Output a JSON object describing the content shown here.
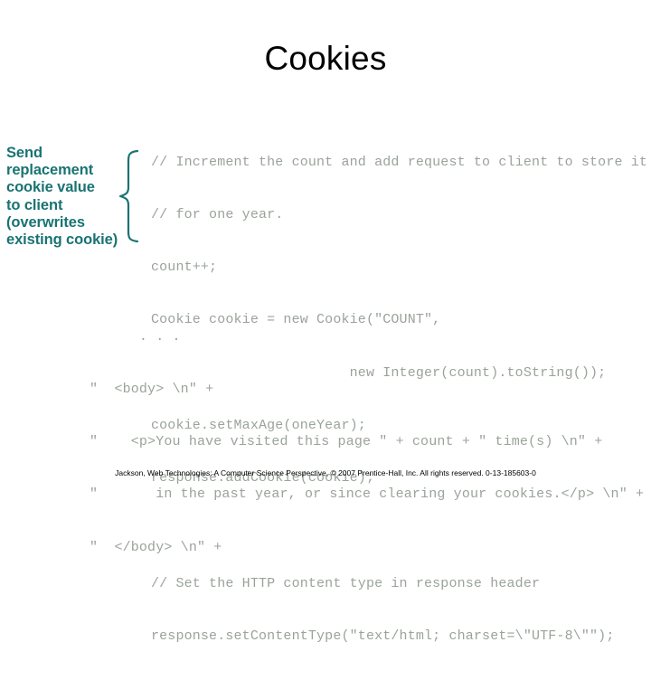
{
  "slide": {
    "title": "Cookies",
    "background_color": "#ffffff",
    "title_color": "#000000"
  },
  "annotation": {
    "color": "#1a7373",
    "lines": [
      "Send",
      "replacement",
      "cookie value",
      "to client",
      "(overwrites",
      "existing cookie)"
    ]
  },
  "brace": {
    "name": "left-curly-brace",
    "color": "#1a7373",
    "orientation": "opening"
  },
  "code": {
    "color": "#9aa39a",
    "lines": [
      "// Increment the count and add request to client to store it",
      "// for one year.",
      "count++;",
      "Cookie cookie = new Cookie(\"COUNT\",",
      "                        new Integer(count).toString());",
      "cookie.setMaxAge(oneYear);",
      "response.addCookie(cookie);",
      "",
      "// Set the HTTP content type in response header",
      "response.setContentType(\"text/html; charset=\\\"UTF-8\\\"\");"
    ]
  },
  "output_code": {
    "color": "#9aa39a",
    "lines": [
      "      . . .",
      "\"  <body> \\n\" +",
      "\"    <p>You have visited this page \" + count + \" time(s) \\n\" +",
      "\"       in the past year, or since clearing your cookies.</p> \\n\" +",
      "\"  </body> \\n\" +"
    ]
  },
  "footer": {
    "text": "Jackson, Web Technologies: A Computer Science Perspective, © 2007 Prentice-Hall, Inc. All rights reserved. 0-13-185603-0"
  }
}
